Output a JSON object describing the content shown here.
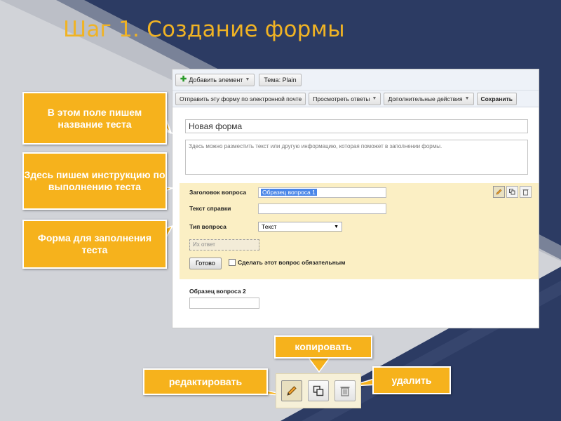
{
  "slide": {
    "title": "Шаг 1. Создание формы"
  },
  "form_ui": {
    "toolbar1": {
      "add_item": "Добавить элемент",
      "theme": "Тема:  Plain"
    },
    "toolbar2": {
      "send_email": "Отправить эту форму по электронной почте",
      "view_answers": "Просмотреть ответы",
      "more_actions": "Дополнительные действия",
      "save": "Сохранить"
    },
    "form_title": "Новая форма",
    "form_description": "Здесь можно разместить текст или другую информацию, которая поможет в заполнении формы.",
    "question1": {
      "title_label": "Заголовок вопроса",
      "title_value": "Образец вопроса 1",
      "help_label": "Текст справки",
      "type_label": "Тип вопроса",
      "type_value": "Текст",
      "answer_placeholder": "Их ответ",
      "done": "Готово",
      "required": "Сделать этот вопрос обязательным"
    },
    "question2": {
      "title": "Образец вопроса 2"
    }
  },
  "callouts": {
    "title_field": "В этом поле пишем название теста",
    "instruction": "Здесь пишем инструкцию по выполнению теста",
    "form": "Форма для заполнения теста",
    "copy": "копировать",
    "edit": "редактировать",
    "delete": "удалить"
  },
  "colors": {
    "accent": "#f6b21c",
    "title": "#f0b324",
    "bg_dark": "#2c3b63",
    "bg_light": "#cfd2d8",
    "question_bg": "#fbefc4"
  },
  "icons": [
    "pencil-icon",
    "copy-icon",
    "trash-icon",
    "plus-icon"
  ]
}
